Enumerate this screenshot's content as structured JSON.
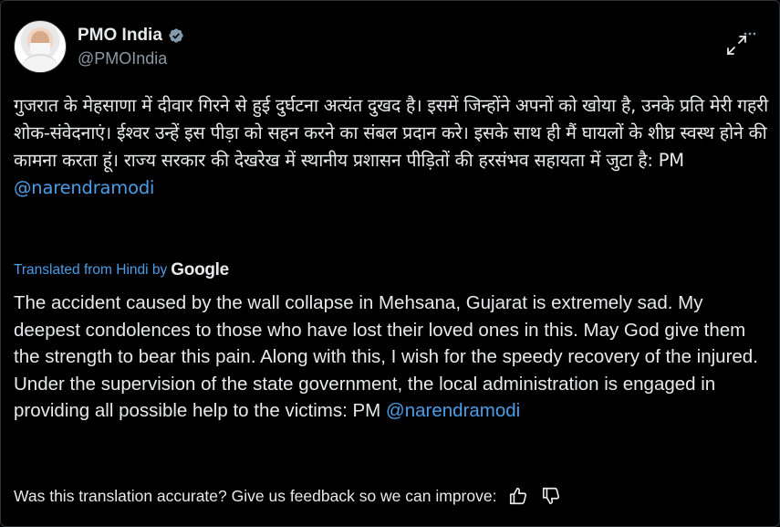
{
  "account": {
    "display_name": "PMO India",
    "handle": "@PMOIndia",
    "verified_icon": "verified-badge-icon",
    "avatar_icon": "profile-avatar"
  },
  "post": {
    "hindi_text": "गुजरात के मेहसाणा में दीवार गिरने से हुई दुर्घटना अत्यंत दुखद है। इसमें जिन्होंने अपनों को खोया है, उनके प्रति मेरी गहरी शोक-संवेदनाएं। ईश्वर उन्हें इस पीड़ा को सहन करने का संबल प्रदान करे। इसके साथ ही मैं घायलों के शीघ्र स्वस्थ होने की कामना करता हूं। राज्य सरकार की देखरेख में स्थानीय प्रशासन पीड़ितों की हरसंभव सहायता में जुटा है: PM",
    "hindi_mention": "@narendramodi",
    "translated_label": "Translated from Hindi by",
    "translator_name": "Google",
    "english_text": "The accident caused by the wall collapse in Mehsana, Gujarat is extremely sad. My deepest condolences to those who have lost their loved ones in this. May God give them the strength to bear this pain. Along with this, I wish for the speedy recovery of the injured. Under the supervision of the state government, the local administration is engaged in providing all possible help to the victims: PM",
    "english_mention": "@narendramodi"
  },
  "feedback": {
    "prompt": "Was this translation accurate? Give us feedback so we can improve:",
    "thumbs_up_icon": "thumbs-up-icon",
    "thumbs_down_icon": "thumbs-down-icon"
  },
  "colors": {
    "background": "#000000",
    "text": "#e7e9ea",
    "secondary_text": "#8b98a5",
    "link": "#4a9de6",
    "verified_badge": "#829aab"
  }
}
